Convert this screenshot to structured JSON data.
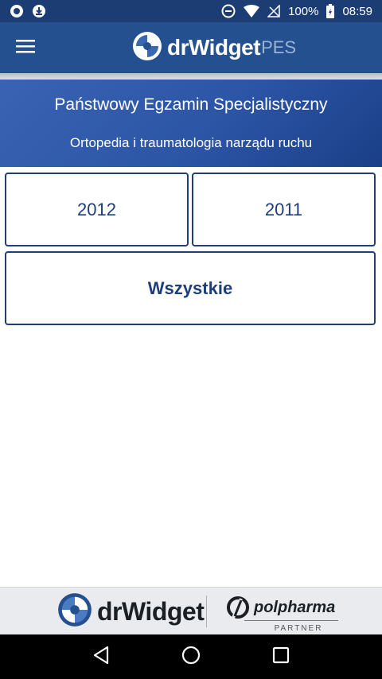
{
  "status_bar": {
    "battery": "100%",
    "time": "08:59"
  },
  "app_bar": {
    "logo_text": "drWidget",
    "logo_suffix": "PES"
  },
  "header": {
    "title": "Państwowy Egzamin Specjalistyczny",
    "subtitle": "Ortopedia i traumatologia narządu ruchu"
  },
  "years": {
    "first": "2012",
    "second": "2011",
    "all": "Wszystkie"
  },
  "footer": {
    "drwidget_text": "drWidget",
    "polpharma_text": "polpharma",
    "partner_text": "PARTNER"
  },
  "colors": {
    "app_bar": "#24508f",
    "status_bar": "#1c3d74",
    "accent": "#1f3e78"
  },
  "icons": {
    "menu": "hamburger-menu-icon",
    "back": "back-triangle-icon",
    "home": "home-circle-icon",
    "recents": "recents-square-icon"
  }
}
